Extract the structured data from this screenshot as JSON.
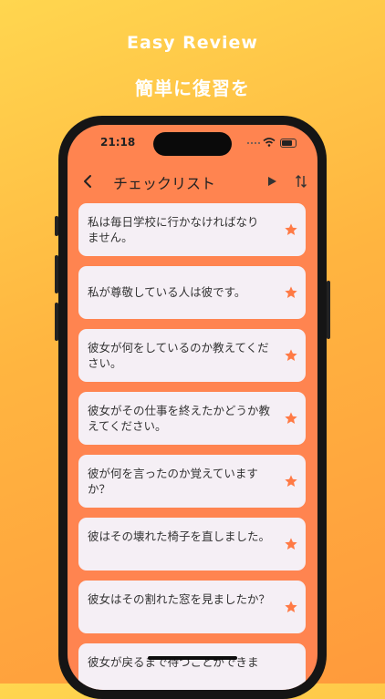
{
  "promo": {
    "title_en": "Easy Review",
    "title_jp": "簡単に復習を"
  },
  "status_bar": {
    "time": "21:18"
  },
  "nav": {
    "title": "チェックリスト",
    "back_icon": "chevron-left-icon",
    "play_icon": "play-icon",
    "sort_icon": "sort-arrows-icon"
  },
  "list": {
    "items": [
      {
        "text": "私は毎日学校に行かなければなりません。",
        "starred": true
      },
      {
        "text": "私が尊敬している人は彼です。",
        "starred": true
      },
      {
        "text": "彼女が何をしているのか教えてください。",
        "starred": true
      },
      {
        "text": "彼女がその仕事を終えたかどうか教えてください。",
        "starred": true
      },
      {
        "text": "彼が何を言ったのか覚えていますか？",
        "starred": true
      },
      {
        "text": "彼はその壊れた椅子を直しました。",
        "starred": true
      },
      {
        "text": "彼女はその割れた窓を見ましたか？",
        "starred": true
      },
      {
        "text": "彼女が戻るまで待つことができま",
        "starred": false
      }
    ]
  },
  "colors": {
    "screen_bg": "#FF8450",
    "card_bg": "#F5EFF5",
    "star": "#FF7A45"
  }
}
